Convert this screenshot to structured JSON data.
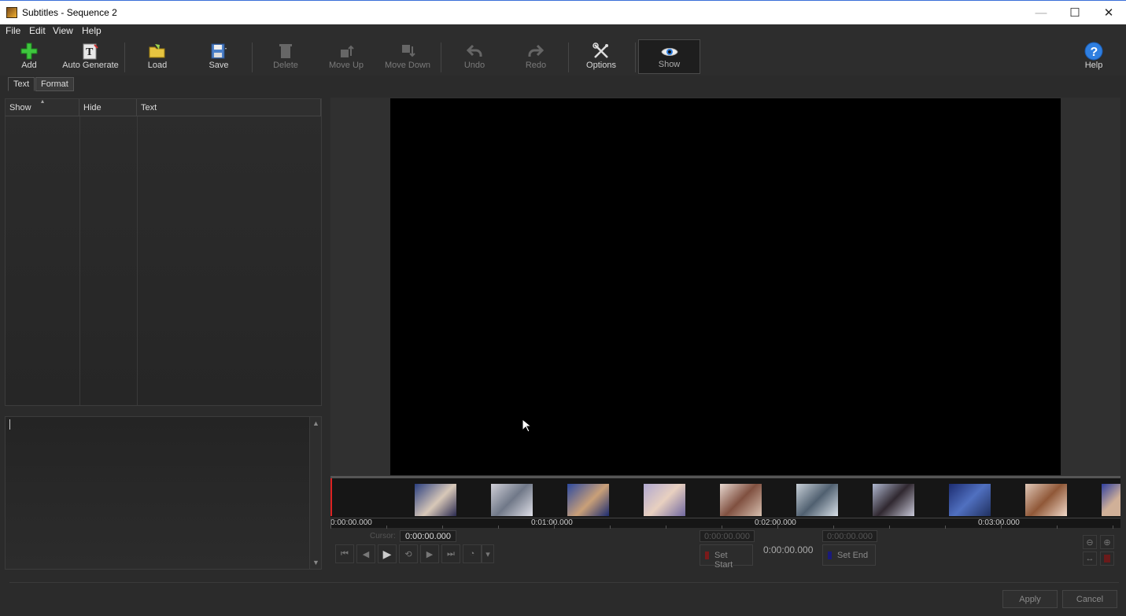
{
  "window": {
    "title": "Subtitles - Sequence 2",
    "minimize": "—",
    "maximize": "☐",
    "close": "✕"
  },
  "menu": [
    "File",
    "Edit",
    "View",
    "Help"
  ],
  "toolbar": {
    "add": "Add",
    "auto_generate": "Auto Generate",
    "load": "Load",
    "save": "Save",
    "delete": "Delete",
    "move_up": "Move Up",
    "move_down": "Move Down",
    "undo": "Undo",
    "redo": "Redo",
    "options": "Options",
    "show": "Show",
    "help": "Help"
  },
  "tabs": {
    "text": "Text",
    "format": "Format"
  },
  "list": {
    "columns": [
      "Show",
      "Hide",
      "Text"
    ],
    "rows": []
  },
  "editor": {
    "value": ""
  },
  "timeline": {
    "ruler": [
      "0:00:00.000",
      "0:01:00.000",
      "0:02:00.000",
      "0:03:00.000"
    ]
  },
  "transport": {
    "cursor_label": "Cursor:",
    "cursor_value": "0:00:00.000",
    "start_value": "0:00:00.000",
    "duration": "0:00:00.000",
    "end_value": "0:00:00.000",
    "set_start": "Set Start",
    "set_end": "Set End"
  },
  "dialog": {
    "apply": "Apply",
    "cancel": "Cancel"
  },
  "colors": {
    "accent": "#3a6fd8",
    "playhead": "#dd2222",
    "add_green": "#3ec63e",
    "help_blue": "#2f7fe0"
  }
}
